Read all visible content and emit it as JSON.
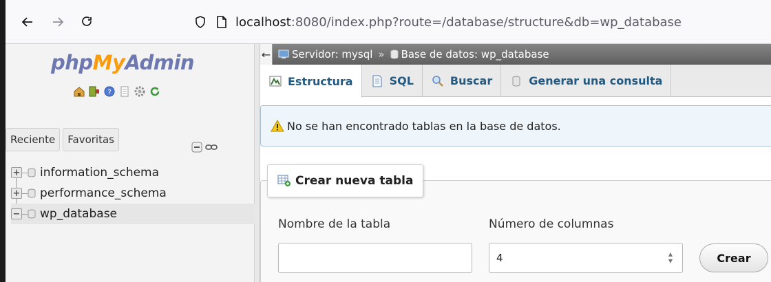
{
  "browser": {
    "url_host": "localhost",
    "url_rest": ":8080/index.php?route=/database/structure&db=wp_database"
  },
  "sidebar": {
    "logo": {
      "part1": "php",
      "part2": "My",
      "part3": "Admin"
    },
    "tabs": [
      {
        "label": "Reciente"
      },
      {
        "label": "Favoritas"
      }
    ],
    "databases": [
      {
        "name": "information_schema",
        "expander": "+"
      },
      {
        "name": "performance_schema",
        "expander": "+"
      },
      {
        "name": "wp_database",
        "expander": "−"
      }
    ]
  },
  "breadcrumb": {
    "server": "Servidor: mysql",
    "separator": "»",
    "database": "Base de datos: wp_database"
  },
  "tabs": [
    {
      "label": "Estructura",
      "icon": "structure-icon"
    },
    {
      "label": "SQL",
      "icon": "sql-icon"
    },
    {
      "label": "Buscar",
      "icon": "search-icon"
    },
    {
      "label": "Generar una consulta",
      "icon": "query-icon"
    }
  ],
  "notice": {
    "text": "No se han encontrado tablas en la base de datos."
  },
  "create_table": {
    "legend": "Crear nueva tabla",
    "name_label": "Nombre de la tabla",
    "name_value": "",
    "columns_label": "Número de columnas",
    "columns_value": "4",
    "submit_label": "Crear"
  },
  "colors": {
    "logo_blue": "#6c78af",
    "logo_orange": "#f89c0e",
    "tab_text": "#235a81",
    "breadcrumb_bg": "#6f6f6f"
  }
}
